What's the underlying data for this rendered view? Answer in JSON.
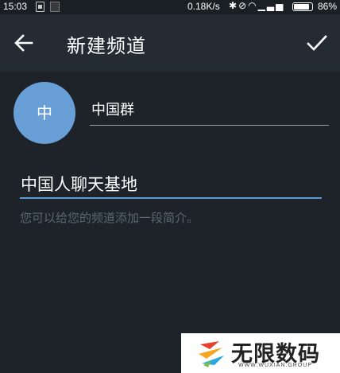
{
  "status_bar": {
    "time": "15:03",
    "network_speed": "0.18K/s",
    "battery_percent": "86%",
    "battery_level": 0.86
  },
  "toolbar": {
    "title": "新建频道",
    "back_icon": "arrow-left-icon",
    "done_icon": "checkmark-icon"
  },
  "channel": {
    "avatar_letter": "中",
    "avatar_color": "#689fd6",
    "name_value": "中国群",
    "description_value": "中国人聊天基地",
    "description_hint": "您可以给您的频道添加一段简介。"
  },
  "watermark": {
    "brand": "无限数码",
    "url": "WWW.WUXIAN.GROUP"
  },
  "colors": {
    "background": "#1d2329",
    "toolbar": "#242b33",
    "accent": "#5b9bd5"
  }
}
